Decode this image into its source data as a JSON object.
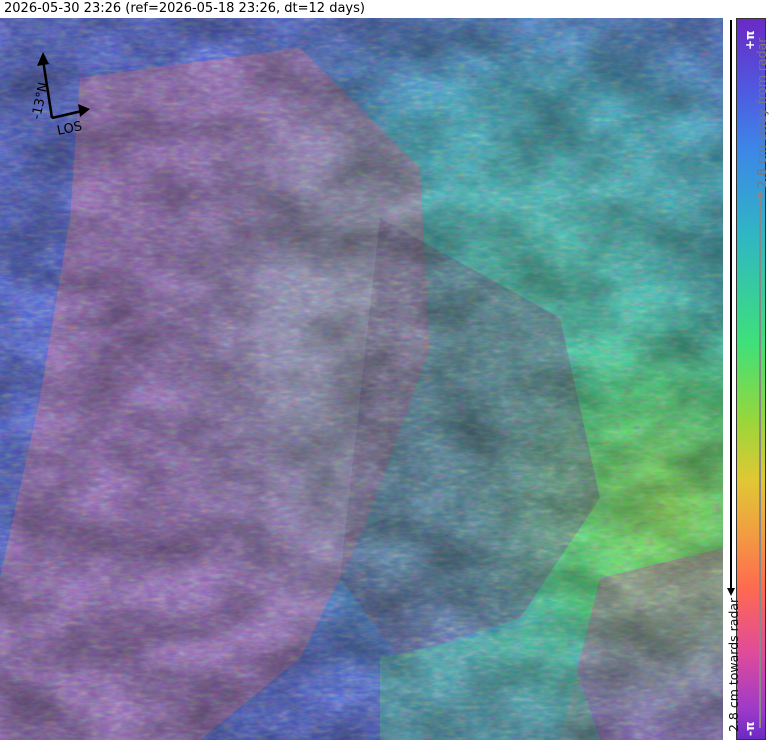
{
  "title": "2026-05-30 23:26 (ref=2026-05-18 23:26, dt=12 days)",
  "compass": {
    "north_label": "-13°N",
    "los_label": "LOS"
  },
  "colorbar": {
    "top_label": "+π",
    "bottom_label": "-π",
    "away_label": "2.8 cm away from radar",
    "towards_label": "2.8 cm towards radar",
    "colors": [
      "#6a2ac4",
      "#4f5ae0",
      "#3d86e8",
      "#2fb6c4",
      "#3ee07a",
      "#9ad63a",
      "#e0c834",
      "#f0a040",
      "#ff6a50",
      "#e04b9a",
      "#9c3ac8"
    ]
  }
}
